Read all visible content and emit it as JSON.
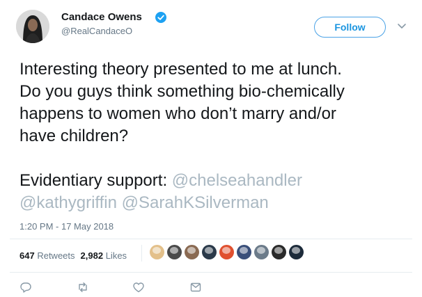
{
  "author": {
    "name": "Candace Owens",
    "handle": "@RealCandaceO",
    "verified": true
  },
  "follow_button": {
    "label": "Follow"
  },
  "tweet": {
    "lines": [
      "Interesting theory presented to me at lunch.",
      "Do you guys think something bio-chemically",
      "happens to women who don’t marry and/or",
      "have children?"
    ],
    "support_prefix": "Evidentiary support: ",
    "mentions": [
      "@chelseahandler",
      "@kathygriffin",
      "@SarahKSilverman"
    ]
  },
  "timestamp": "1:20 PM - 17 May 2018",
  "stats": {
    "retweets_count": "647",
    "retweets_label": "Retweets",
    "likes_count": "2,982",
    "likes_label": "Likes"
  },
  "likers": [
    {
      "color": "#e3c08a"
    },
    {
      "color": "#4a4a4a"
    },
    {
      "color": "#8a6a52"
    },
    {
      "color": "#2b3a4a"
    },
    {
      "color": "#e0502f"
    },
    {
      "color": "#3a4f7a"
    },
    {
      "color": "#6c7b8a"
    },
    {
      "color": "#2a2a2a"
    },
    {
      "color": "#1d2b3a"
    }
  ],
  "actions": [
    "reply-icon",
    "retweet-icon",
    "like-icon",
    "message-icon"
  ],
  "colors": {
    "link": "#1b95e0",
    "mention": "#aab8c2",
    "muted": "#657786",
    "verified": "#1da1f2"
  }
}
